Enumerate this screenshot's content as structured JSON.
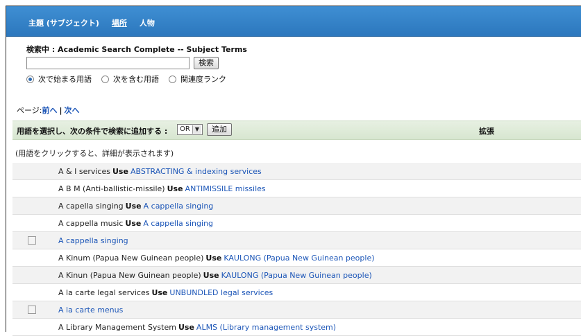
{
  "nav": {
    "tabs": [
      "主題 (サブジェクト)",
      "場所",
      "人物"
    ]
  },
  "search": {
    "searching_label": "検索中 : Academic Search Complete -- Subject Terms",
    "input_value": "",
    "button_label": "検索",
    "options": [
      {
        "label": "次で始まる用語",
        "selected": true
      },
      {
        "label": "次を含む用語",
        "selected": false
      },
      {
        "label": "関連度ランク",
        "selected": false
      }
    ]
  },
  "pager": {
    "label": "ページ:",
    "prev": "前へ",
    "sep": "|",
    "next": "次へ"
  },
  "action_bar": {
    "label": "用語を選択し、次の条件で検索に追加する :",
    "operator": "OR",
    "add_button": "追加",
    "expand_header": "拡張"
  },
  "hint": "(用語をクリックすると、詳細が表示されます)",
  "terms": [
    {
      "term": "A & I services",
      "use": "Use",
      "target": "ABSTRACTING & indexing services",
      "checkbox": false
    },
    {
      "term": "A B M (Anti-ballistic-missile)",
      "use": "Use",
      "target": "ANTIMISSILE missiles",
      "checkbox": false
    },
    {
      "term": "A capella singing",
      "use": "Use",
      "target": "A cappella singing",
      "checkbox": false
    },
    {
      "term": "A cappella music",
      "use": "Use",
      "target": "A cappella singing",
      "checkbox": false
    },
    {
      "term": "",
      "use": "",
      "target": "A cappella singing",
      "checkbox": true
    },
    {
      "term": "A Kinum (Papua New Guinean people)",
      "use": "Use",
      "target": "KAULONG (Papua New Guinean people)",
      "checkbox": false
    },
    {
      "term": "A Kinun (Papua New Guinean people)",
      "use": "Use",
      "target": "KAULONG (Papua New Guinean people)",
      "checkbox": false
    },
    {
      "term": "A la carte legal services",
      "use": "Use",
      "target": "UNBUNDLED legal services",
      "checkbox": false
    },
    {
      "term": "",
      "use": "",
      "target": "A la carte menus",
      "checkbox": true
    },
    {
      "term": "A Library Management System",
      "use": "Use",
      "target": "ALMS (Library management system)",
      "checkbox": false
    }
  ]
}
